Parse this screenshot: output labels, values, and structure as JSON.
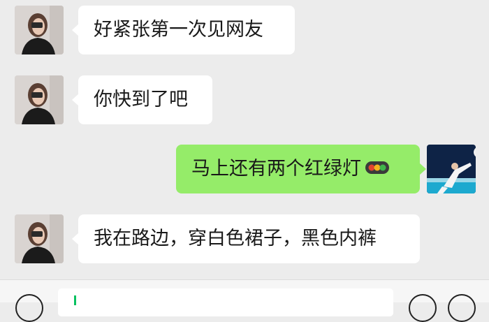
{
  "messages": [
    {
      "side": "left",
      "text": "好紧张第一次见网友"
    },
    {
      "side": "left",
      "text": "你快到了吧"
    },
    {
      "side": "right",
      "text": "马上还有两个红绿灯",
      "emoji": "traffic-light-icon"
    },
    {
      "side": "left",
      "text": "我在路边，穿白色裙子，黑色内裤"
    }
  ],
  "colors": {
    "background": "#ececec",
    "incoming_bubble": "#ffffff",
    "outgoing_bubble": "#95ec69",
    "text": "#191919",
    "cursor": "#07c160"
  },
  "input_bar": {
    "left_icon": "voice-icon",
    "right_icons": [
      "emoji-icon",
      "plus-icon"
    ]
  }
}
